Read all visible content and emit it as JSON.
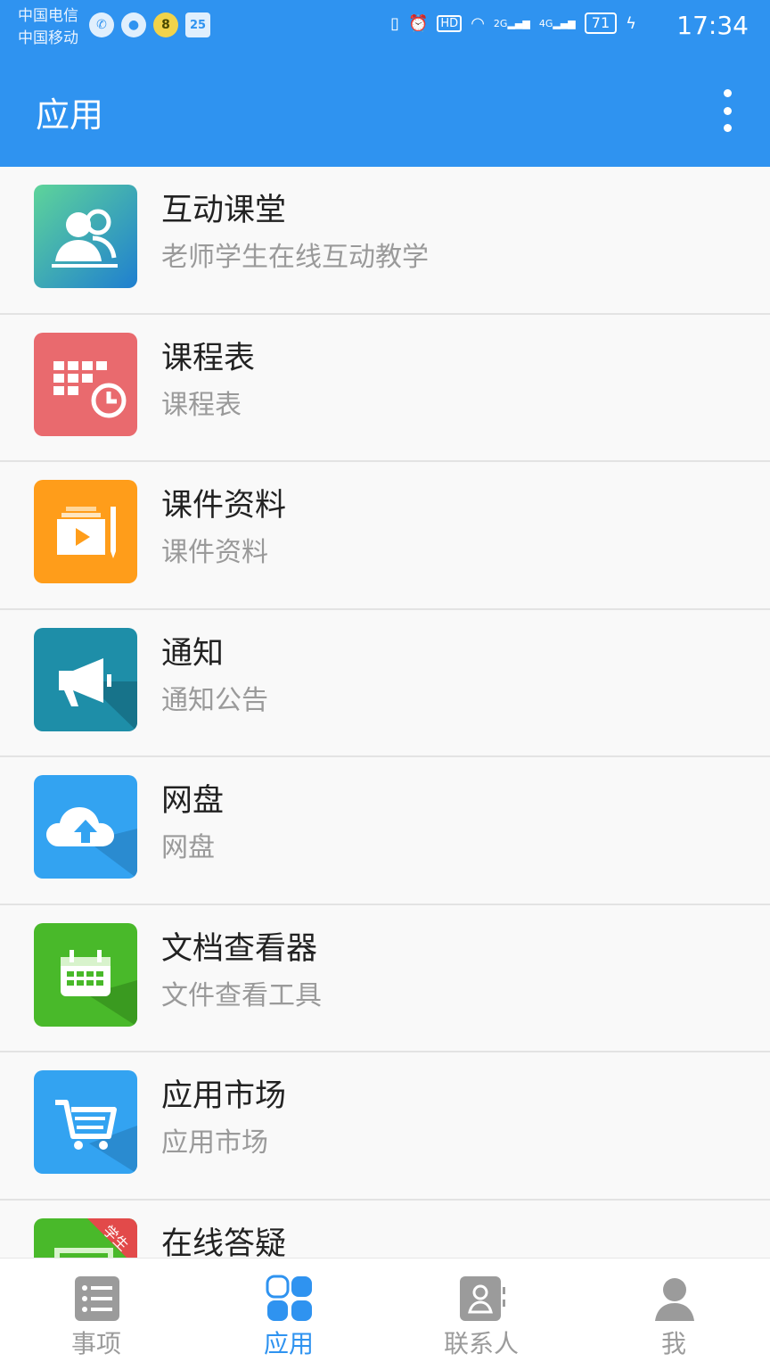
{
  "status_bar": {
    "carrier_1": "中国电信",
    "carrier_2": "中国移动",
    "notif_badge_1": "8",
    "notif_badge_2": "25",
    "network_1": "2G",
    "network_2": "4G",
    "hd": "HD",
    "battery": "71",
    "time": "17:34"
  },
  "app_bar": {
    "title": "应用"
  },
  "apps": [
    {
      "title": "互动课堂",
      "subtitle": "老师学生在线互动教学",
      "icon": "interactive-class-icon",
      "color": "#3aa8a6"
    },
    {
      "title": "课程表",
      "subtitle": "课程表",
      "icon": "timetable-icon",
      "color": "#e96a6e"
    },
    {
      "title": "课件资料",
      "subtitle": "课件资料",
      "icon": "courseware-icon",
      "color": "#ff9d1a"
    },
    {
      "title": "通知",
      "subtitle": "通知公告",
      "icon": "megaphone-icon",
      "color": "#1e8ea8"
    },
    {
      "title": "网盘",
      "subtitle": "网盘",
      "icon": "cloud-upload-icon",
      "color": "#33a3f1"
    },
    {
      "title": "文档查看器",
      "subtitle": "文件查看工具",
      "icon": "calendar-doc-icon",
      "color": "#49b92a"
    },
    {
      "title": "应用市场",
      "subtitle": "应用市场",
      "icon": "shopping-cart-icon",
      "color": "#33a3f1"
    },
    {
      "title": "在线答疑",
      "subtitle": "",
      "icon": "qa-icon",
      "color": "#49b92a",
      "badge": "学生"
    }
  ],
  "tab_bar": {
    "tabs": [
      {
        "label": "事项",
        "icon": "list-icon"
      },
      {
        "label": "应用",
        "icon": "apps-icon",
        "active": true
      },
      {
        "label": "联系人",
        "icon": "contacts-icon"
      },
      {
        "label": "我",
        "icon": "person-icon"
      }
    ]
  },
  "colors": {
    "primary": "#2f93f0",
    "inactive": "#9b9b9b"
  }
}
